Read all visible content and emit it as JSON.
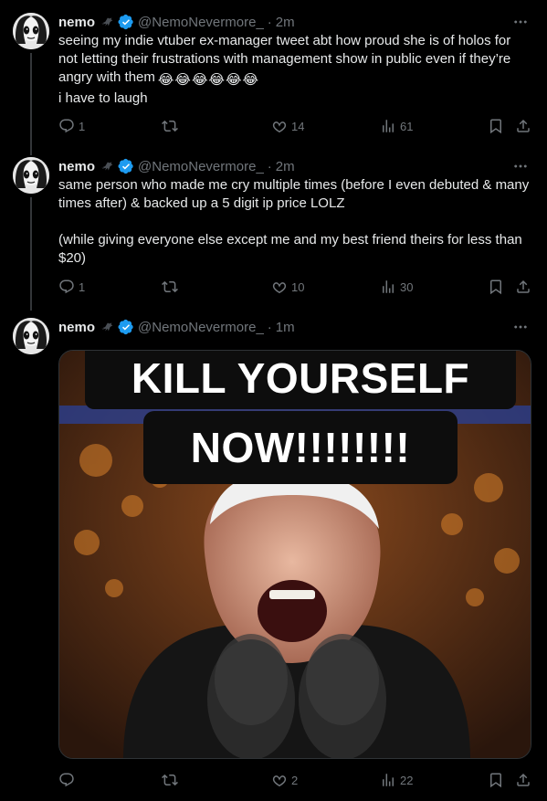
{
  "tweets": [
    {
      "name": "nemo",
      "handle": "@NemoNevermore_",
      "time": "2m",
      "text": "seeing my indie vtuber ex-manager tweet abt how proud she is of holos for not letting their frustrations with management show in public even if they’re angry with them",
      "text_after": "i have to laugh",
      "emojis": [
        "😂",
        "😂",
        "😂",
        "😂",
        "😂",
        "😂"
      ],
      "replies": "1",
      "retweets": "",
      "likes": "14",
      "views": "61"
    },
    {
      "name": "nemo",
      "handle": "@NemoNevermore_",
      "time": "2m",
      "text": "same person who made me cry multiple times (before I even debuted & many times after) & backed up a 5 digit ip price LOLZ\n\n(while giving everyone else except me and my best friend theirs for less than $20)",
      "replies": "1",
      "retweets": "",
      "likes": "10",
      "views": "30"
    },
    {
      "name": "nemo",
      "handle": "@NemoNevermore_",
      "time": "1m",
      "media_caption_line1": "KILL YOURSELF",
      "media_caption_line2": "NOW!!!!!!!!",
      "replies": "",
      "retweets": "",
      "likes": "2",
      "views": "22"
    }
  ],
  "separator": "·",
  "icons": {
    "more": "more-dots-icon",
    "bird": "raven-icon",
    "verified": "verified-badge-icon",
    "reply": "reply-icon",
    "retweet": "retweet-icon",
    "like": "heart-icon",
    "views": "views-icon",
    "bookmark": "bookmark-icon",
    "share": "share-icon"
  },
  "colors": {
    "background": "#000000",
    "text": "#e7e9ea",
    "muted": "#71767b",
    "verified": "#1d9bf0",
    "border": "#2f3336"
  }
}
